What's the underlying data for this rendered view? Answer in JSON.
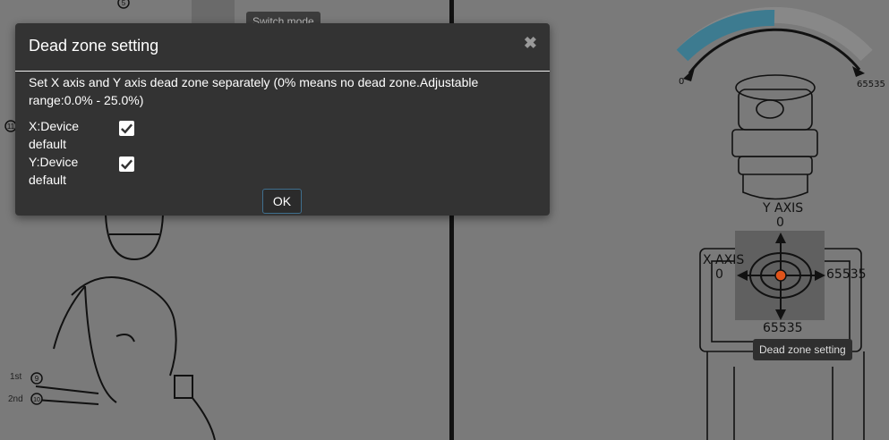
{
  "dialog": {
    "title": "Dead zone setting",
    "close_glyph": "✖",
    "description": "Set X axis and Y axis dead zone separately (0% means no dead zone.Adjustable range:0.0% - 25.0%)",
    "x_label": "X:Device default",
    "x_checked": true,
    "y_label": "Y:Device default",
    "y_checked": true,
    "ok_label": "OK"
  },
  "background": {
    "switch_mode_tooltip": "Switch mode",
    "dead_zone_tooltip": "Dead zone setting",
    "gauge_min": "0",
    "gauge_max": "65535",
    "y_axis_label": "Y AXIS",
    "y_axis_top": "0",
    "y_axis_bottom": "65535",
    "x_axis_label": "X AXIS",
    "x_axis_left": "0",
    "x_axis_right": "65535",
    "stage_1st": "1st",
    "stage_2nd": "2nd",
    "badge_5": "5",
    "badge_9": "9",
    "badge_10": "10",
    "badge_11": "11",
    "gauge_fill_fraction": 0.5
  },
  "colors": {
    "gauge_fill": "#3d7b90",
    "indicator": "#e0541b",
    "dialog_bg": "#333333"
  }
}
